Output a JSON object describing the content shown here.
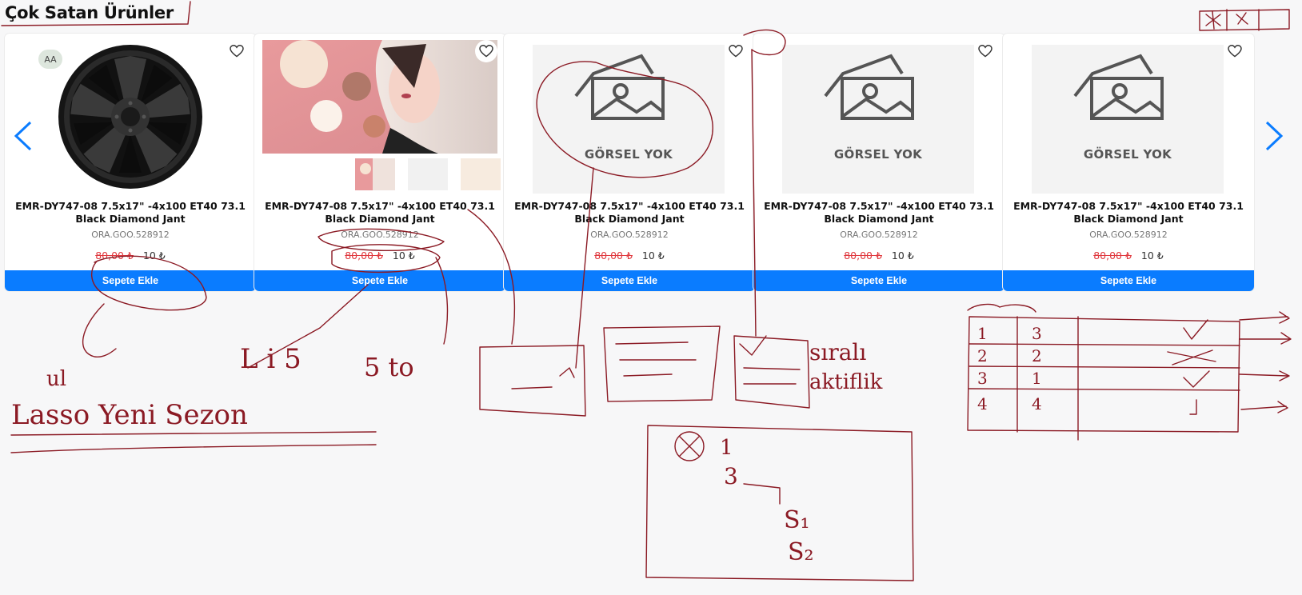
{
  "section": {
    "title": "Çok Satan Ürünler"
  },
  "products": [
    {
      "name": "EMR-DY747-08 7.5x17\" -4x100 ET40 73.1 Black Diamond Jant",
      "sku": "ORA.GOO.528912",
      "old_price": "80,00 ₺",
      "new_price": "10 ₺",
      "cart_label": "Sepete Ekle",
      "badge": "AA",
      "image": "wheel"
    },
    {
      "name": "EMR-DY747-08 7.5x17\" -4x100 ET40 73.1 Black Diamond Jant",
      "sku": "ORA.GOO.528912",
      "old_price": "80,00 ₺",
      "new_price": "10 ₺",
      "cart_label": "Sepete Ekle",
      "image": "photo"
    },
    {
      "name": "EMR-DY747-08 7.5x17\" -4x100 ET40 73.1 Black Diamond Jant",
      "sku": "ORA.GOO.528912",
      "old_price": "80,00 ₺",
      "new_price": "10 ₺",
      "cart_label": "Sepete Ekle",
      "image": "none",
      "no_image_label": "GÖRSEL YOK"
    },
    {
      "name": "EMR-DY747-08 7.5x17\" -4x100 ET40 73.1 Black Diamond Jant",
      "sku": "ORA.GOO.528912",
      "old_price": "80,00 ₺",
      "new_price": "10 ₺",
      "cart_label": "Sepete Ekle",
      "image": "none",
      "no_image_label": "GÖRSEL YOK"
    },
    {
      "name": "EMR-DY747-08 7.5x17\" -4x100 ET40 73.1 Black Diamond Jant",
      "sku": "ORA.GOO.528912",
      "old_price": "80,00 ₺",
      "new_price": "10 ₺",
      "cart_label": "Sepete Ekle",
      "image": "none",
      "no_image_label": "GÖRSEL YOK"
    }
  ],
  "icons": {
    "favorite": "heart-icon",
    "prev": "chevron-left-icon",
    "next": "chevron-right-icon",
    "no_image": "image-placeholder-icon"
  },
  "colors": {
    "accent": "#0a7cff",
    "old_price": "#e0383e",
    "annotation": "#8b1a24",
    "placeholder_bg": "#f3f3f3"
  }
}
